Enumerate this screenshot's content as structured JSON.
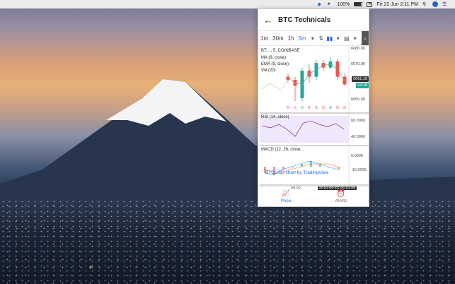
{
  "menubar": {
    "battery": "100%",
    "input_letter": "A",
    "datetime": "Fri 22 Jun  2:11 PM"
  },
  "app": {
    "title": "BTC Technicals",
    "timeframes": [
      "1m",
      "30m",
      "1h",
      "5m"
    ],
    "active_timeframe": "5m",
    "symbol": "BT... , 5, COINBASE",
    "indicators": {
      "ma": "MA (9, close)",
      "ema": "EMA (9, close)",
      "vol": "Vol (20)",
      "rsi": "RSI (14, close)",
      "macd": "MACD (12, 26, close..."
    },
    "price_axis": [
      "6680.00",
      "6670.00",
      "6661.19",
      "6650.00"
    ],
    "price_tag": "6661.19",
    "price_tag2": "03:18",
    "rsi_axis": [
      "60.0000",
      "40.0000"
    ],
    "macd_axis": [
      "0.0000",
      "-10.0000"
    ],
    "watermark": "BTCUSD chart by TradingView",
    "time_label": "04:30",
    "time_cursor": "2018-06-22 06:15:00",
    "nav": {
      "price": "Price",
      "alerts": "Alerts"
    }
  },
  "chart_data": {
    "type": "candlestick",
    "candles": [
      {
        "o": 6666,
        "c": 6664,
        "h": 6668,
        "l": 6662,
        "dir": "down"
      },
      {
        "o": 6664,
        "c": 6660,
        "h": 6666,
        "l": 6650,
        "dir": "down"
      },
      {
        "o": 6652,
        "c": 6670,
        "h": 6672,
        "l": 6650,
        "dir": "up"
      },
      {
        "o": 6670,
        "c": 6666,
        "h": 6674,
        "l": 6662,
        "dir": "down"
      },
      {
        "o": 6666,
        "c": 6675,
        "h": 6677,
        "l": 6664,
        "dir": "up"
      },
      {
        "o": 6675,
        "c": 6672,
        "h": 6677,
        "l": 6670,
        "dir": "down"
      },
      {
        "o": 6672,
        "c": 6676,
        "h": 6679,
        "l": 6671,
        "dir": "up"
      },
      {
        "o": 6676,
        "c": 6666,
        "h": 6678,
        "l": 6664,
        "dir": "down"
      },
      {
        "o": 6666,
        "c": 6661,
        "h": 6668,
        "l": 6660,
        "dir": "down"
      }
    ],
    "rsi": [
      52,
      48,
      55,
      45,
      30,
      58,
      62,
      55,
      50,
      57,
      45
    ],
    "macd": [
      -2,
      -3,
      -1,
      0,
      1,
      2,
      1,
      0,
      -1
    ],
    "macd_signal": [
      -1,
      -2,
      -2,
      -1,
      0,
      1,
      1,
      1,
      0
    ]
  }
}
